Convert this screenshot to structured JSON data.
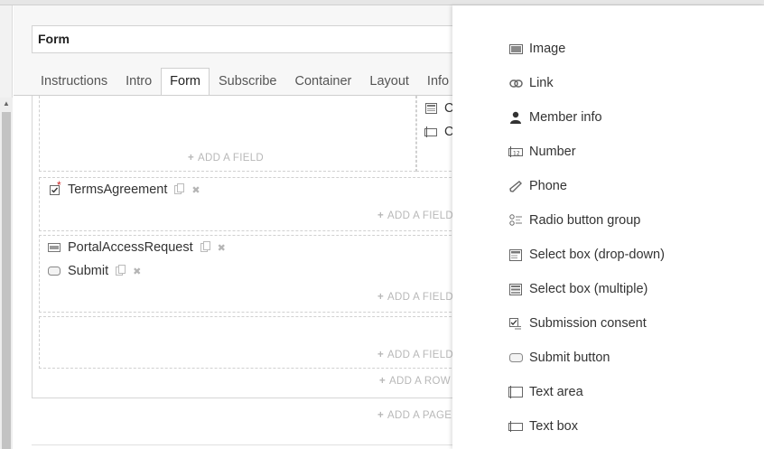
{
  "form_name": "Form",
  "tabs": [
    {
      "label": "Instructions"
    },
    {
      "label": "Intro"
    },
    {
      "label": "Form"
    },
    {
      "label": "Subscribe"
    },
    {
      "label": "Container"
    },
    {
      "label": "Layout"
    },
    {
      "label": "Info"
    }
  ],
  "canvas": {
    "add_field": "ADD A FIELD",
    "add_row": "ADD A ROW",
    "add_page": "ADD A PAGE",
    "partial_items": [
      "C",
      "C"
    ],
    "fields": [
      {
        "label": "TermsAgreement",
        "required_marker": "*"
      },
      {
        "label": "PortalAccessRequest"
      },
      {
        "label": "Submit"
      }
    ]
  },
  "palette": {
    "items": [
      {
        "label": "Image",
        "icon": "image-icon"
      },
      {
        "label": "Link",
        "icon": "link-icon"
      },
      {
        "label": "Member info",
        "icon": "person-icon"
      },
      {
        "label": "Number",
        "icon": "number-field-icon"
      },
      {
        "label": "Phone",
        "icon": "phone-icon"
      },
      {
        "label": "Radio button group",
        "icon": "radio-group-icon"
      },
      {
        "label": "Select box (drop-down)",
        "icon": "dropdown-icon"
      },
      {
        "label": "Select box (multiple)",
        "icon": "multi-select-icon"
      },
      {
        "label": "Submission consent",
        "icon": "consent-icon"
      },
      {
        "label": "Submit button",
        "icon": "button-icon"
      },
      {
        "label": "Text area",
        "icon": "text-area-icon"
      },
      {
        "label": "Text box",
        "icon": "text-box-icon"
      }
    ]
  }
}
